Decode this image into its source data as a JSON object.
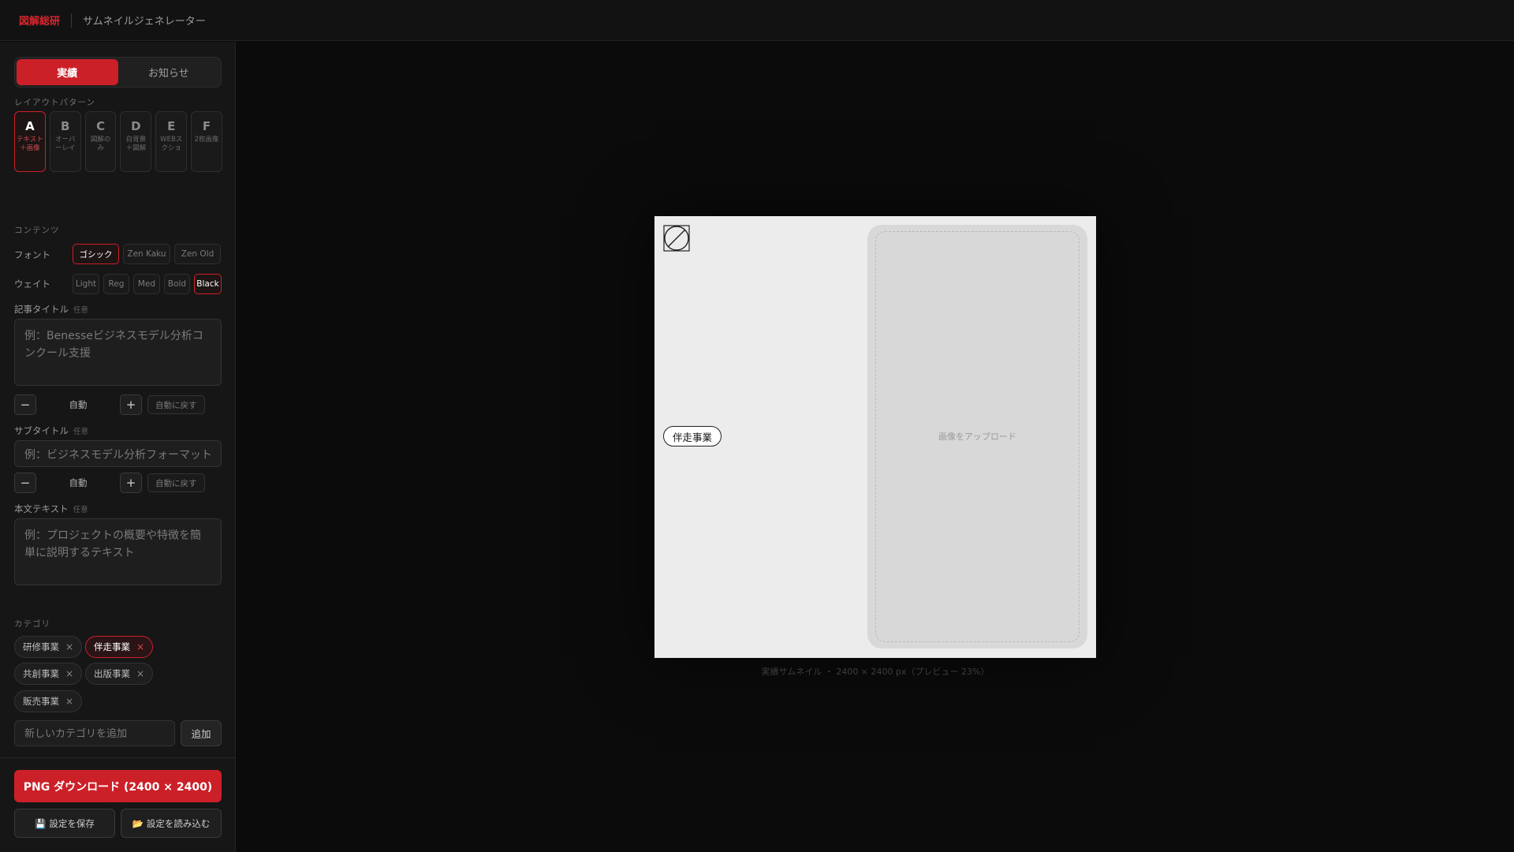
{
  "header": {
    "brand": "図解総研",
    "app_title": "サムネイルジェネレーター"
  },
  "tabs": [
    {
      "label": "実績",
      "active": true
    },
    {
      "label": "お知らせ",
      "active": false
    }
  ],
  "layout_section": {
    "label": "レイアウトパターン",
    "patterns": [
      {
        "letter": "A",
        "desc": "テキスト＋画像",
        "active": true
      },
      {
        "letter": "B",
        "desc": "オーバーレイ",
        "active": false
      },
      {
        "letter": "C",
        "desc": "図解のみ",
        "active": false
      },
      {
        "letter": "D",
        "desc": "白背景＋図解",
        "active": false
      },
      {
        "letter": "E",
        "desc": "WEBスクショ",
        "active": false
      },
      {
        "letter": "F",
        "desc": "2枚画像",
        "active": false
      }
    ]
  },
  "content_section": {
    "label": "コンテンツ",
    "font_label": "フォント",
    "fonts": [
      {
        "label": "ゴシック",
        "active": true
      },
      {
        "label": "Zen Kaku",
        "active": false
      },
      {
        "label": "Zen Old",
        "active": false
      }
    ],
    "weight_label": "ウェイト",
    "weights": [
      {
        "label": "Light",
        "active": false
      },
      {
        "label": "Reg",
        "active": false
      },
      {
        "label": "Med",
        "active": false
      },
      {
        "label": "Bold",
        "active": false
      },
      {
        "label": "Black",
        "active": true
      }
    ]
  },
  "title_field": {
    "label": "記事タイトル",
    "optional": "任意",
    "placeholder": "例：Benesseビジネスモデル分析コンクール支援",
    "stepper_value": "自動",
    "reset": "自動に戻す"
  },
  "subtitle_field": {
    "label": "サブタイトル",
    "optional": "任意",
    "placeholder": "例：ビジネスモデル分析フォーマット",
    "stepper_value": "自動",
    "reset": "自動に戻す"
  },
  "body_field": {
    "label": "本文テキスト",
    "optional": "任意",
    "placeholder": "例：プロジェクトの概要や特徴を簡単に説明するテキスト"
  },
  "category_section": {
    "label": "カテゴリ",
    "chips": [
      {
        "label": "研修事業",
        "active": false
      },
      {
        "label": "伴走事業",
        "active": true
      },
      {
        "label": "共創事業",
        "active": false
      },
      {
        "label": "出版事業",
        "active": false
      },
      {
        "label": "販売事業",
        "active": false
      }
    ],
    "remove_glyph": "×",
    "add_placeholder": "新しいカテゴリを追加",
    "add_button": "追加"
  },
  "actions": {
    "download": "PNG ダウンロード (2400 × 2400)",
    "save": "設定を保存",
    "save_icon": "💾",
    "load": "設定を読み込む",
    "load_icon": "📂"
  },
  "preview": {
    "category_badge": "伴走事業",
    "upload_text": "画像をアップロード",
    "caption": "実績サムネイル ・ 2400 × 2400 px（プレビュー 23%）",
    "background_color": "#ececec"
  },
  "colors": {
    "accent": "#cc2029",
    "background": "#0b0b0b",
    "sidebar": "#161616"
  }
}
